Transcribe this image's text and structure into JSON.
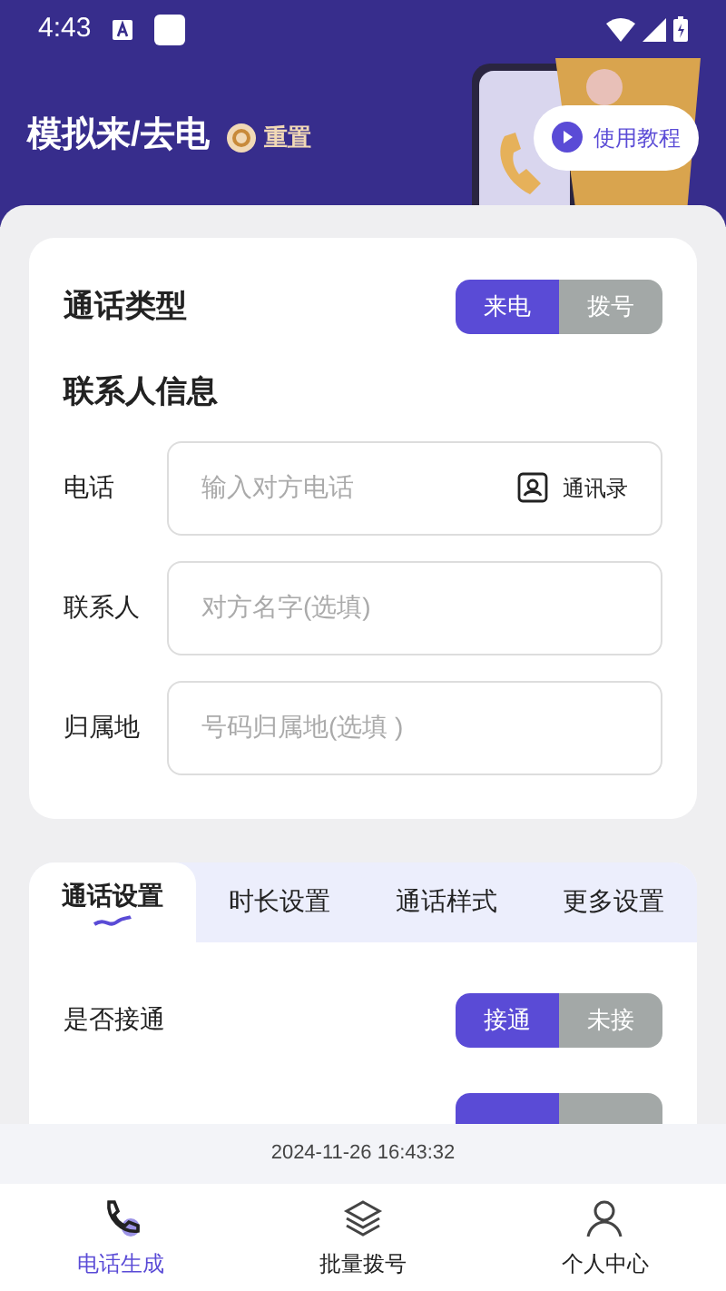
{
  "status_bar": {
    "time": "4:43"
  },
  "header": {
    "title": "模拟来/去电",
    "reset": "重置",
    "tutorial": "使用教程"
  },
  "call_type": {
    "label": "通话类型",
    "options": [
      {
        "label": "来电",
        "selected": true
      },
      {
        "label": "拨号",
        "selected": false
      }
    ]
  },
  "contact": {
    "title": "联系人信息",
    "fields": [
      {
        "label": "电话",
        "placeholder": "输入对方电话",
        "action": "通讯录"
      },
      {
        "label": "联系人",
        "placeholder": "对方名字(选填)"
      },
      {
        "label": "归属地",
        "placeholder": "号码归属地(选填 )"
      }
    ]
  },
  "settings_tabs": [
    {
      "label": "通话设置",
      "selected": true
    },
    {
      "label": "时长设置",
      "selected": false
    },
    {
      "label": "通话样式",
      "selected": false
    },
    {
      "label": "更多设置",
      "selected": false
    }
  ],
  "settings": [
    {
      "label": "是否接通",
      "options": [
        {
          "label": "接通",
          "selected": true
        },
        {
          "label": "未接",
          "selected": false
        }
      ]
    }
  ],
  "partial_setting": {
    "options": [
      {
        "selected": true
      },
      {
        "selected": false
      }
    ]
  },
  "timestamp": "2024-11-26 16:43:32",
  "bottom_nav": [
    {
      "label": "电话生成",
      "selected": true
    },
    {
      "label": "批量拨号",
      "selected": false
    },
    {
      "label": "个人中心",
      "selected": false
    }
  ]
}
